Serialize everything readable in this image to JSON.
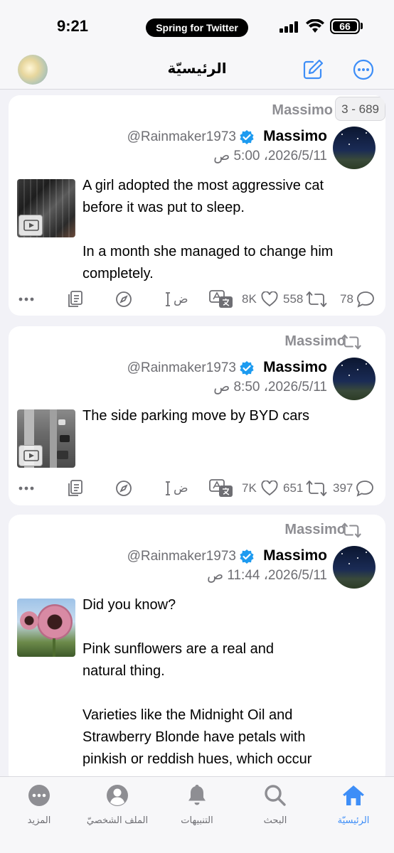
{
  "status_bar": {
    "time": "9:21",
    "pill_label": "Spring for Twitter",
    "battery": "66"
  },
  "header": {
    "title": "الرئيسيّة"
  },
  "posts": [
    {
      "retweeted_by": "Massimo",
      "counter": "3 - 689",
      "name": "Massimo",
      "handle": "@Rainmaker1973",
      "time": "2026/5/11، 5:00 ص",
      "text": "A girl adopted the most aggressive cat\nbefore it was put to sleep.\n\nIn a month she managed to change him\ncompletely.",
      "likes": "8K",
      "retweets": "558",
      "replies": "78"
    },
    {
      "retweeted_by": "Massimo",
      "name": "Massimo",
      "handle": "@Rainmaker1973",
      "time": "2026/5/11، 8:50 ص",
      "text": "The side parking move by BYD cars",
      "likes": "7K",
      "retweets": "651",
      "replies": "397"
    },
    {
      "retweeted_by": "Massimo",
      "name": "Massimo",
      "handle": "@Rainmaker1973",
      "time": "2026/5/11، 11:44 ص",
      "text": "Did you know?\n\nPink sunflowers are a real and\nnatural thing.\n\nVarieties like the Midnight Oil and\nStrawberry Blonde have petals with\npinkish or reddish hues, which occur"
    }
  ],
  "action_glyph": "ض",
  "tabs": [
    {
      "label": "المزيد",
      "icon": "more-icon"
    },
    {
      "label": "الملف الشخصيّ",
      "icon": "profile-icon"
    },
    {
      "label": "التنبيهات",
      "icon": "bell-icon"
    },
    {
      "label": "البحث",
      "icon": "search-icon"
    },
    {
      "label": "الرئيسيّة",
      "icon": "home-icon"
    }
  ],
  "colors": {
    "accent": "#3e8ef7",
    "verified": "#1d9bf0",
    "muted": "#6e6e73"
  }
}
